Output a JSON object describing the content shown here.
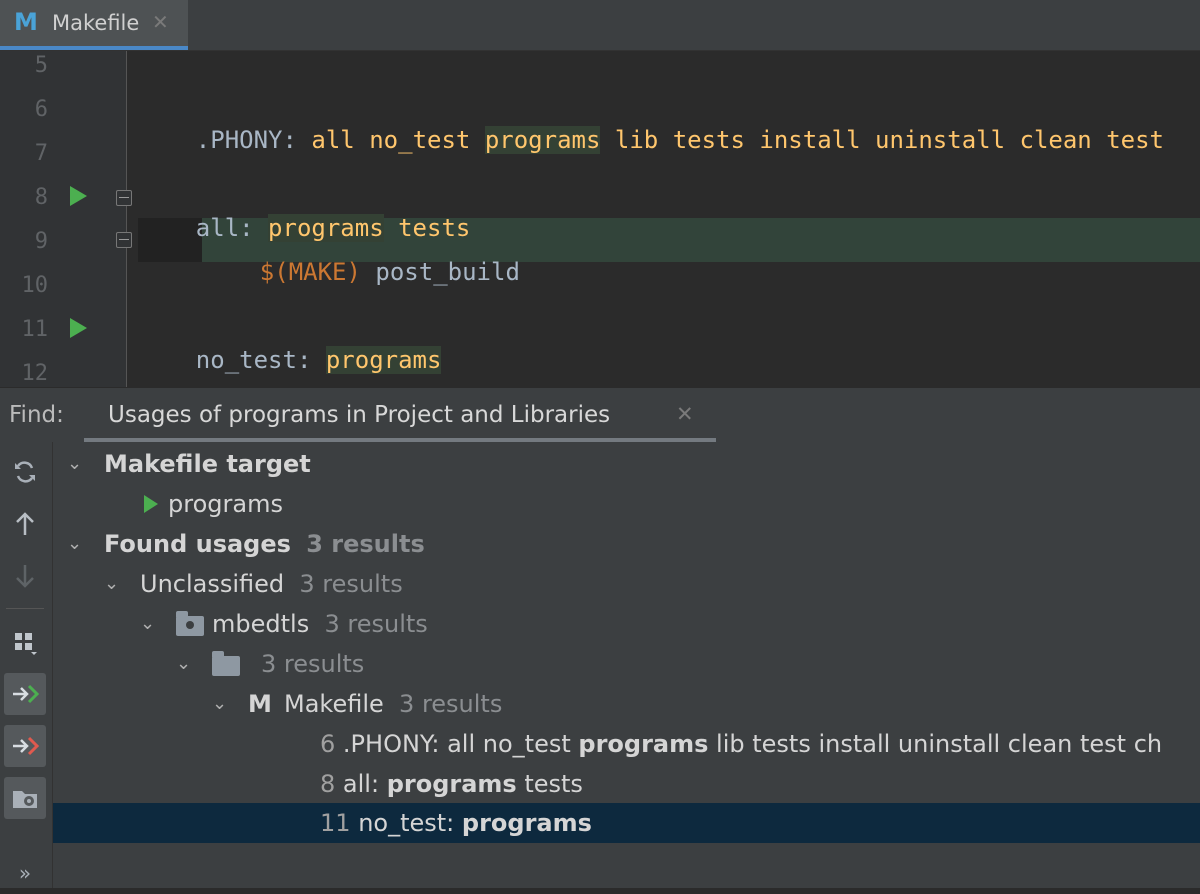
{
  "tab": {
    "icon": "M",
    "label": "Makefile",
    "close": "✕"
  },
  "editor": {
    "lines": [
      {
        "num": "5"
      },
      {
        "num": "6",
        "target": ".PHONY:",
        "deps": [
          "all",
          "no_test",
          "programs",
          "lib",
          "tests",
          "install",
          "uninstall",
          "clean",
          "test"
        ]
      },
      {
        "num": "7"
      },
      {
        "num": "8",
        "target": "all:",
        "deps": [
          "programs",
          "tests"
        ]
      },
      {
        "num": "9",
        "var": "$(MAKE)",
        "cmd": "post_build"
      },
      {
        "num": "10"
      },
      {
        "num": "11",
        "target": "no_test:",
        "deps": [
          "programs"
        ]
      },
      {
        "num": "12"
      }
    ]
  },
  "find": {
    "label": "Find:",
    "tab_label": "Usages of programs in Project and Libraries",
    "tab_close": "✕"
  },
  "toolbar": {
    "buttons": [
      "rerun-icon",
      "arrow-up-icon",
      "arrow-down-icon",
      "group-icon",
      "merge-left-icon",
      "merge-right-icon",
      "folder-settings-icon",
      "more-icon"
    ],
    "more": "»"
  },
  "tree": {
    "makefile_target": {
      "label": "Makefile target",
      "child": "programs"
    },
    "found_usages": {
      "label": "Found usages",
      "count": "3 results"
    },
    "unclassified": {
      "label": "Unclassified",
      "count": "3 results"
    },
    "mbedtls": {
      "label": "mbedtls",
      "count": "3 results"
    },
    "folder": {
      "count": "3 results"
    },
    "makefile": {
      "icon": "M",
      "label": "Makefile",
      "count": "3 results"
    },
    "results": [
      {
        "line": "6",
        "before": ".PHONY: all no_test ",
        "match": "programs",
        "after": " lib tests install uninstall clean test ch"
      },
      {
        "line": "8",
        "before": "all: ",
        "match": "programs",
        "after": " tests"
      },
      {
        "line": "11",
        "before": "no_test: ",
        "match": "programs",
        "after": ""
      }
    ]
  },
  "colors": {
    "accent": "#4a88c7",
    "run_green": "#4caf50",
    "selected_row": "#0d293e",
    "dep_yellow": "#ffc66d",
    "make_orange": "#cc7832"
  }
}
